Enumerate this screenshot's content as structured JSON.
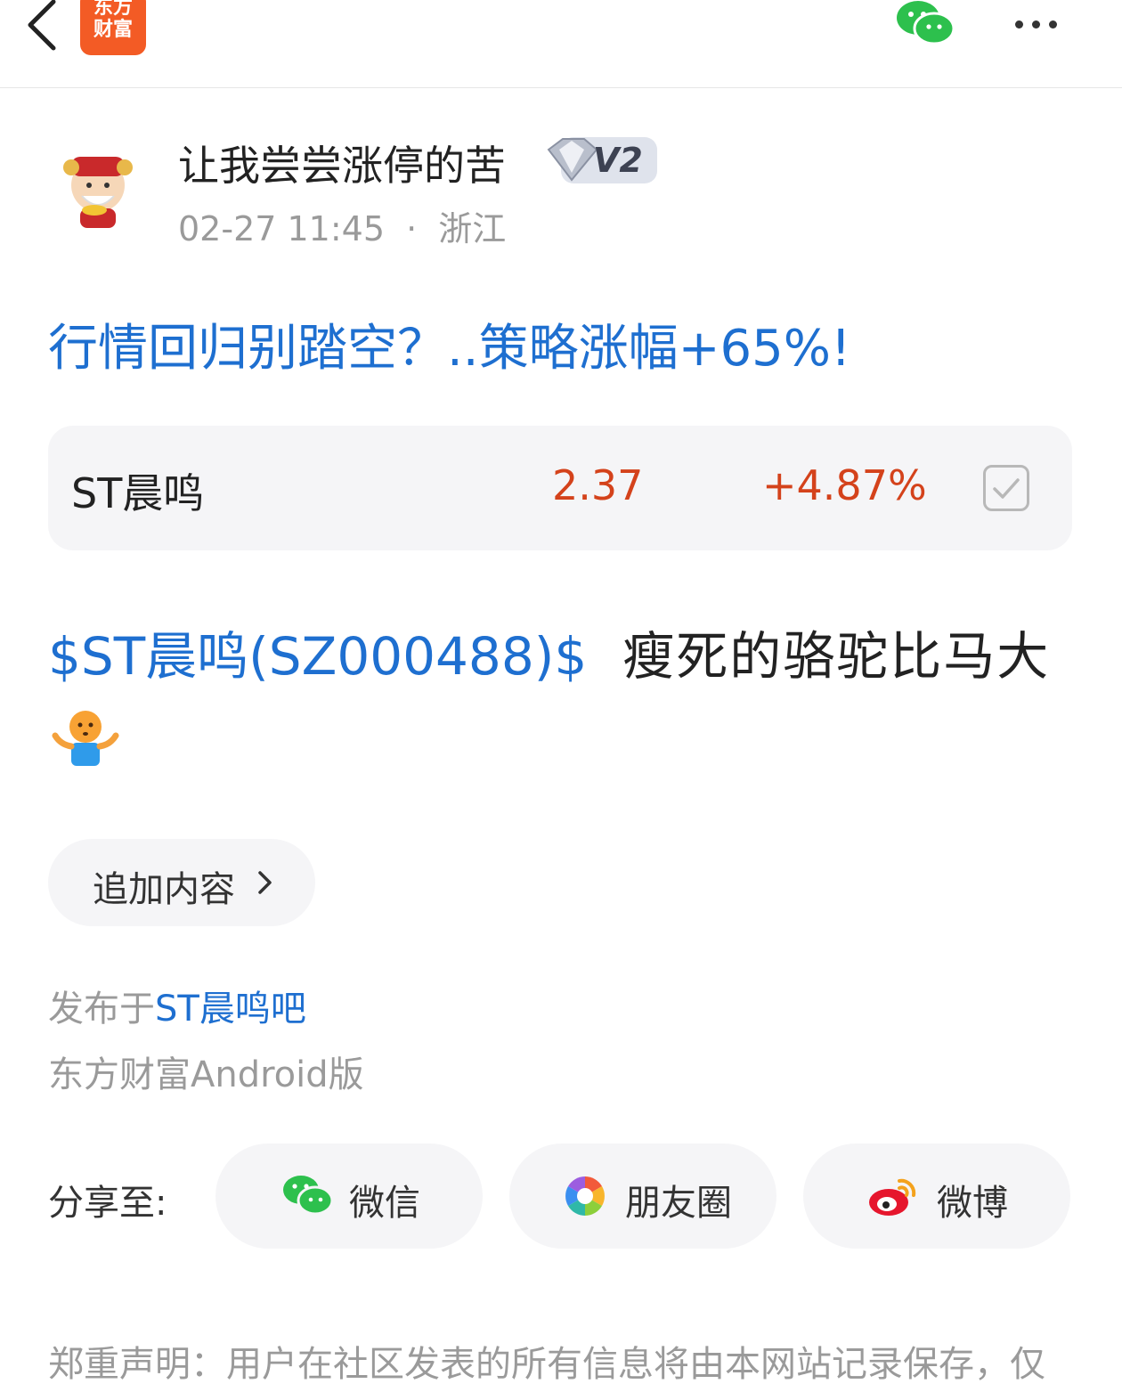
{
  "header": {
    "logo_text_line1": "东方",
    "logo_text_line2": "财富",
    "back_icon": "chevron-left-icon",
    "share_icon": "wechat-icon",
    "more_icon": "more-icon"
  },
  "post": {
    "author": "让我尝尝涨停的苦",
    "level_badge": "V2",
    "datetime": "02-27 11:45",
    "separator": "·",
    "location": "浙江",
    "title": "行情回归别踏空？..策略涨幅+65%!",
    "stock": {
      "name": "ST晨鸣",
      "price": "2.37",
      "change": "+4.87%",
      "checked": true
    },
    "body_link": "$ST晨鸣(SZ000488)$",
    "body_text": "瘦死的骆驼比马大",
    "emoji": "shrug-emoji"
  },
  "add_content": {
    "label": "追加内容"
  },
  "published_prefix": "发布于",
  "published_bar": "ST晨鸣吧",
  "client": "东方财富Android版",
  "share": {
    "label": "分享至:",
    "buttons": [
      {
        "label": "微信",
        "icon": "wechat-icon"
      },
      {
        "label": "朋友圈",
        "icon": "moments-icon"
      },
      {
        "label": "微博",
        "icon": "weibo-icon"
      }
    ]
  },
  "disclaimer": "郑重声明：用户在社区发表的所有信息将由本网站记录保存，仅",
  "colors": {
    "accent_blue": "#1e6fd0",
    "up_red": "#d4421b",
    "brand_orange": "#f35b25"
  }
}
